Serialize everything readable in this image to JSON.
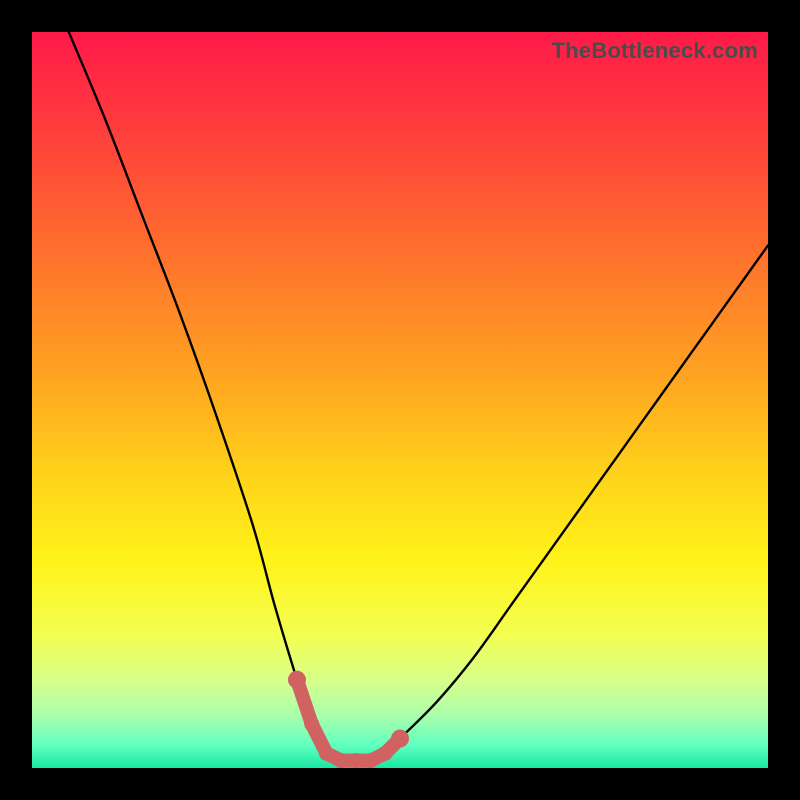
{
  "watermark": "TheBottleneck.com",
  "colors": {
    "frame": "#000000",
    "curve": "#000000",
    "markers": "#d06262",
    "gradient_stops": [
      {
        "offset": 0.0,
        "color": "#ff1a49"
      },
      {
        "offset": 0.12,
        "color": "#ff3a3d"
      },
      {
        "offset": 0.28,
        "color": "#ff6a2f"
      },
      {
        "offset": 0.45,
        "color": "#ff9e22"
      },
      {
        "offset": 0.6,
        "color": "#ffd21a"
      },
      {
        "offset": 0.72,
        "color": "#fff31a"
      },
      {
        "offset": 0.82,
        "color": "#f3ff52"
      },
      {
        "offset": 0.88,
        "color": "#d8ff8a"
      },
      {
        "offset": 0.93,
        "color": "#a8ffad"
      },
      {
        "offset": 0.97,
        "color": "#5effc0"
      },
      {
        "offset": 1.0,
        "color": "#18e8a0"
      }
    ]
  },
  "chart_data": {
    "type": "line",
    "title": "",
    "xlabel": "",
    "ylabel": "",
    "xlim": [
      0,
      100
    ],
    "ylim": [
      0,
      100
    ],
    "series": [
      {
        "name": "bottleneck-curve",
        "x": [
          5,
          10,
          15,
          20,
          25,
          30,
          33,
          36,
          38,
          40,
          42,
          44,
          46,
          48,
          50,
          55,
          60,
          65,
          70,
          75,
          80,
          85,
          90,
          95,
          100
        ],
        "values": [
          100,
          88,
          75,
          62,
          48,
          33,
          22,
          12,
          6,
          2,
          1,
          1,
          1,
          2,
          4,
          9,
          15,
          22,
          29,
          36,
          43,
          50,
          57,
          64,
          71
        ]
      }
    ],
    "markers": {
      "name": "highlight-points",
      "x": [
        36,
        38,
        40,
        42,
        44,
        46,
        48,
        50
      ],
      "values": [
        12,
        6,
        2,
        1,
        1,
        1,
        2,
        4
      ]
    }
  }
}
